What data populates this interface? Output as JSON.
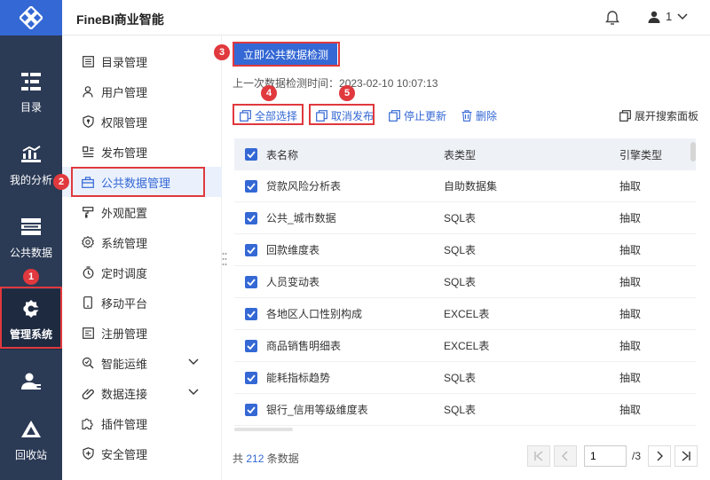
{
  "app": {
    "title": "FineBI商业智能"
  },
  "header": {
    "user_count": "1"
  },
  "rail": [
    {
      "label": "目录",
      "icon": "catalog-icon"
    },
    {
      "label": "我的分析",
      "icon": "analysis-icon"
    },
    {
      "label": "公共数据",
      "icon": "public-data-icon"
    },
    {
      "label": "管理系统",
      "icon": "admin-gear-icon",
      "active": true
    },
    {
      "label": "",
      "icon": "user-manage-icon"
    },
    {
      "label": "回收站",
      "icon": "recycle-icon"
    }
  ],
  "menu": [
    {
      "label": "目录管理",
      "icon": "catalog-manage-icon"
    },
    {
      "label": "用户管理",
      "icon": "user-icon"
    },
    {
      "label": "权限管理",
      "icon": "shield-icon"
    },
    {
      "label": "发布管理",
      "icon": "publish-icon"
    },
    {
      "label": "公共数据管理",
      "icon": "briefcase-icon",
      "active": true
    },
    {
      "label": "外观配置",
      "icon": "palette-icon"
    },
    {
      "label": "系统管理",
      "icon": "gear-icon"
    },
    {
      "label": "定时调度",
      "icon": "timer-icon"
    },
    {
      "label": "移动平台",
      "icon": "mobile-icon"
    },
    {
      "label": "注册管理",
      "icon": "register-icon"
    },
    {
      "label": "智能运维",
      "icon": "ops-icon",
      "expandable": true
    },
    {
      "label": "数据连接",
      "icon": "link-icon",
      "expandable": true
    },
    {
      "label": "插件管理",
      "icon": "plugin-icon"
    },
    {
      "label": "安全管理",
      "icon": "security-icon"
    }
  ],
  "main": {
    "detect_button": "立即公共数据检测",
    "last_check_label": "上一次数据检测时间：",
    "last_check_time": "2023-02-10 10:07:13",
    "actions": {
      "select_all": "全部选择",
      "unpublish": "取消发布",
      "stop_update": "停止更新",
      "delete": "删除",
      "expand_search": "展开搜索面板"
    },
    "table": {
      "headers": [
        "表名称",
        "表类型",
        "引擎类型"
      ],
      "rows": [
        [
          "贷款风险分析表",
          "自助数据集",
          "抽取"
        ],
        [
          "公共_城市数据",
          "SQL表",
          "抽取"
        ],
        [
          "回款维度表",
          "SQL表",
          "抽取"
        ],
        [
          "人员变动表",
          "SQL表",
          "抽取"
        ],
        [
          "各地区人口性别构成",
          "EXCEL表",
          "抽取"
        ],
        [
          "商品销售明细表",
          "EXCEL表",
          "抽取"
        ],
        [
          "能耗指标趋势",
          "SQL表",
          "抽取"
        ],
        [
          "银行_信用等级维度表",
          "SQL表",
          "抽取"
        ]
      ]
    },
    "footer": {
      "total_prefix": "共",
      "total_count": "212",
      "total_suffix": "条数据",
      "current_page": "1",
      "total_pages": "/3"
    }
  },
  "annotations": [
    "1",
    "2",
    "3",
    "4",
    "5"
  ],
  "colors": {
    "accent": "#3468d4",
    "rail_bg": "#2b3a55",
    "annotation": "#e0393e"
  }
}
